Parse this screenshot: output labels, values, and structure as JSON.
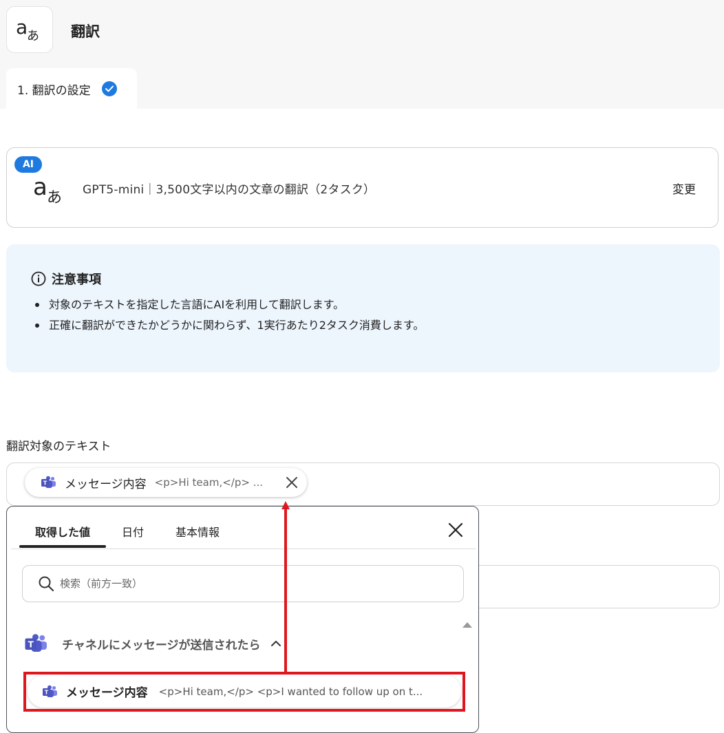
{
  "app": {
    "title": "翻訳",
    "icon": "translate-icon"
  },
  "steps": [
    {
      "label": "1. 翻訳の設定",
      "status": "done",
      "icon": "check-circle-icon"
    }
  ],
  "model_card": {
    "badge": "AI",
    "icon": "translate-icon",
    "description": "GPT5-mini｜3,500文字以内の文章の翻訳（2タスク）",
    "change_label": "変更"
  },
  "notice": {
    "icon": "info-icon",
    "title": "注意事項",
    "items": [
      "対象のテキストを指定した言語にAIを利用して翻訳します。",
      "正確に翻訳ができたかどうかに関わらず、1実行あたり2タスク消費します。"
    ]
  },
  "field": {
    "label": "翻訳対象のテキスト",
    "chip": {
      "icon": "teams-icon",
      "label": "メッセージ内容",
      "value": "<p>Hi team,</p> ...",
      "close_icon": "close-icon"
    }
  },
  "popover": {
    "tabs": [
      {
        "label": "取得した値",
        "active": true
      },
      {
        "label": "日付",
        "active": false
      },
      {
        "label": "基本情報",
        "active": false
      }
    ],
    "close_icon": "close-icon",
    "search": {
      "placeholder": "検索（前方一致）",
      "value": "",
      "icon": "search-icon"
    },
    "section": {
      "icon": "teams-icon",
      "title": "チャネルにメッセージが送信されたら",
      "chevron": "chevron-up-icon"
    },
    "items": [
      {
        "icon": "teams-icon",
        "label": "メッセージ内容",
        "value": "<p>Hi team,</p> <p>I wanted to follow up on t..."
      }
    ]
  },
  "colors": {
    "accent": "#1f7ae0",
    "highlight": "#e0161f",
    "notice_bg": "#edf5fd"
  }
}
